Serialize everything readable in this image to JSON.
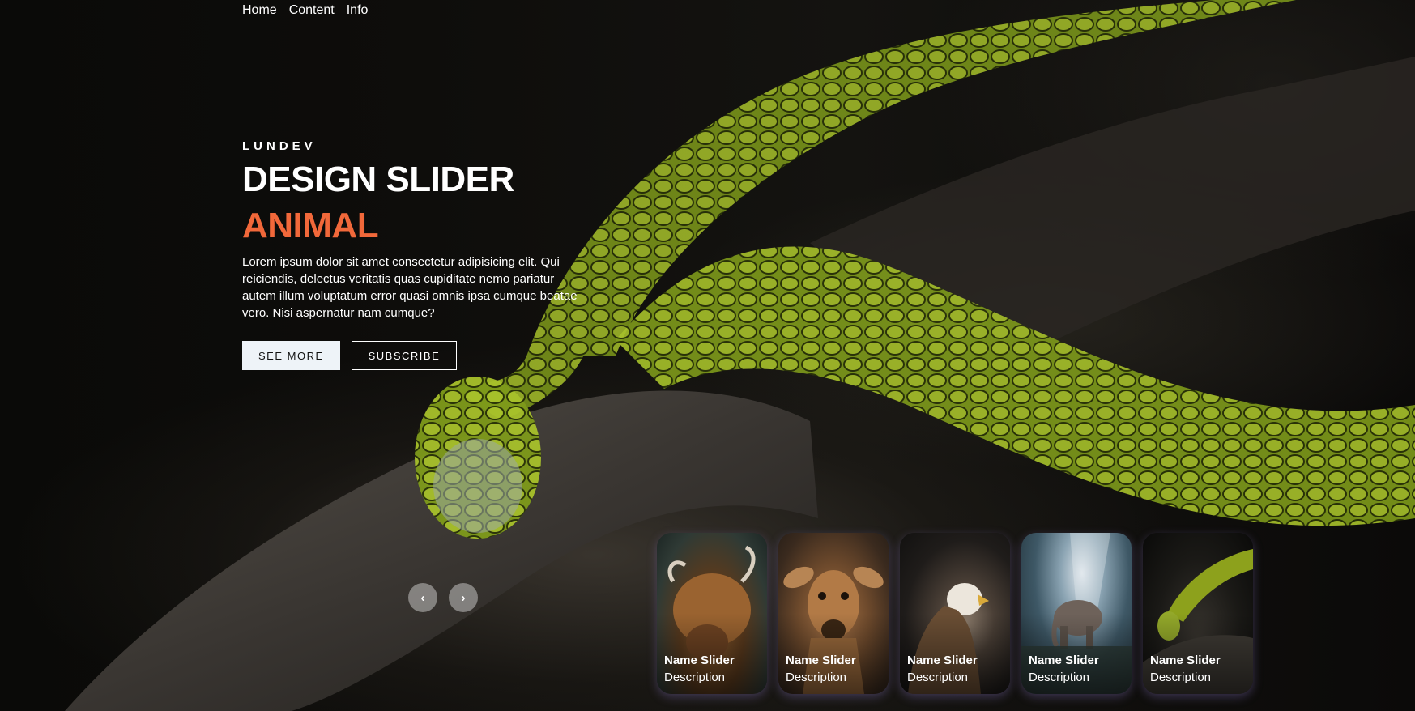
{
  "nav": {
    "items": [
      "Home",
      "Content",
      "Info"
    ]
  },
  "hero": {
    "author": "LUNDEV",
    "title": "DESIGN SLIDER",
    "topic": "ANIMAL",
    "description": "Lorem ipsum dolor sit amet consectetur adipisicing elit. Qui reiciendis, delectus veritatis quas cupiditate nemo pariatur autem illum voluptatum error quasi omnis ipsa cumque beatae vero. Nisi aspernatur nam cumque?",
    "see_more_label": "SEE MORE",
    "subscribe_label": "SUBSCRIBE"
  },
  "arrows": {
    "prev": "‹",
    "next": "›"
  },
  "thumbnails": [
    {
      "name": "Name Slider",
      "description": "Description",
      "image": "highland-cow"
    },
    {
      "name": "Name Slider",
      "description": "Description",
      "image": "deer"
    },
    {
      "name": "Name Slider",
      "description": "Description",
      "image": "eagle"
    },
    {
      "name": "Name Slider",
      "description": "Description",
      "image": "elephant"
    },
    {
      "name": "Name Slider",
      "description": "Description",
      "image": "green-snake"
    }
  ],
  "colors": {
    "accent": "#f1683a",
    "background": "#050505",
    "snake": "#8fa41c"
  }
}
